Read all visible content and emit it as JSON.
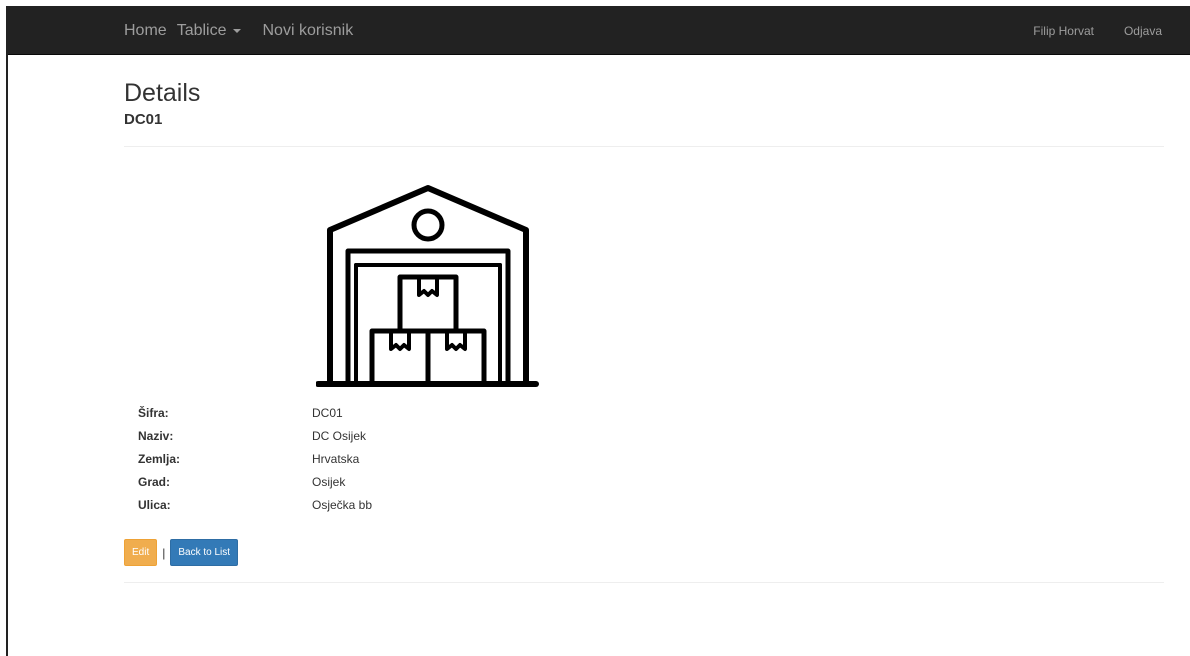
{
  "nav": {
    "home": "Home",
    "tables": "Tablice",
    "new_user": "Novi korisnik",
    "user_name": "Filip Horvat",
    "logout": "Odjava"
  },
  "page": {
    "title": "Details",
    "subtitle": "DC01"
  },
  "image": {
    "icon": "warehouse-icon"
  },
  "details": [
    {
      "label": "Šifra:",
      "value": "DC01"
    },
    {
      "label": "Naziv:",
      "value": "DC Osijek"
    },
    {
      "label": "Zemlja:",
      "value": "Hrvatska"
    },
    {
      "label": "Grad:",
      "value": "Osijek"
    },
    {
      "label": "Ulica:",
      "value": "Osječka bb"
    }
  ],
  "actions": {
    "edit": "Edit",
    "separator": "|",
    "back": "Back to List"
  },
  "colors": {
    "navbar": "#222222",
    "nav_text": "#9d9d9d",
    "edit_button": "#f0ad4e",
    "back_button": "#337ab7"
  }
}
